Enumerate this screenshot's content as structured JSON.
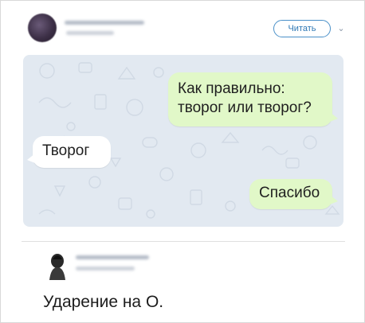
{
  "header": {
    "follow_label": "Читать",
    "menu_icon": "chevron-down-icon"
  },
  "chat": {
    "messages": [
      {
        "side": "outgoing",
        "lines": [
          "Как правильно:",
          "творог или творог?"
        ]
      },
      {
        "side": "incoming",
        "text": "Творог"
      },
      {
        "side": "outgoing",
        "text": "Спасибо"
      }
    ],
    "colors": {
      "background": "#e2e9f1",
      "outgoing": "#e1f8c8",
      "incoming": "#ffffff"
    }
  },
  "reply": {
    "text": "Ударение на О."
  },
  "colors": {
    "accent": "#2f78b5"
  }
}
